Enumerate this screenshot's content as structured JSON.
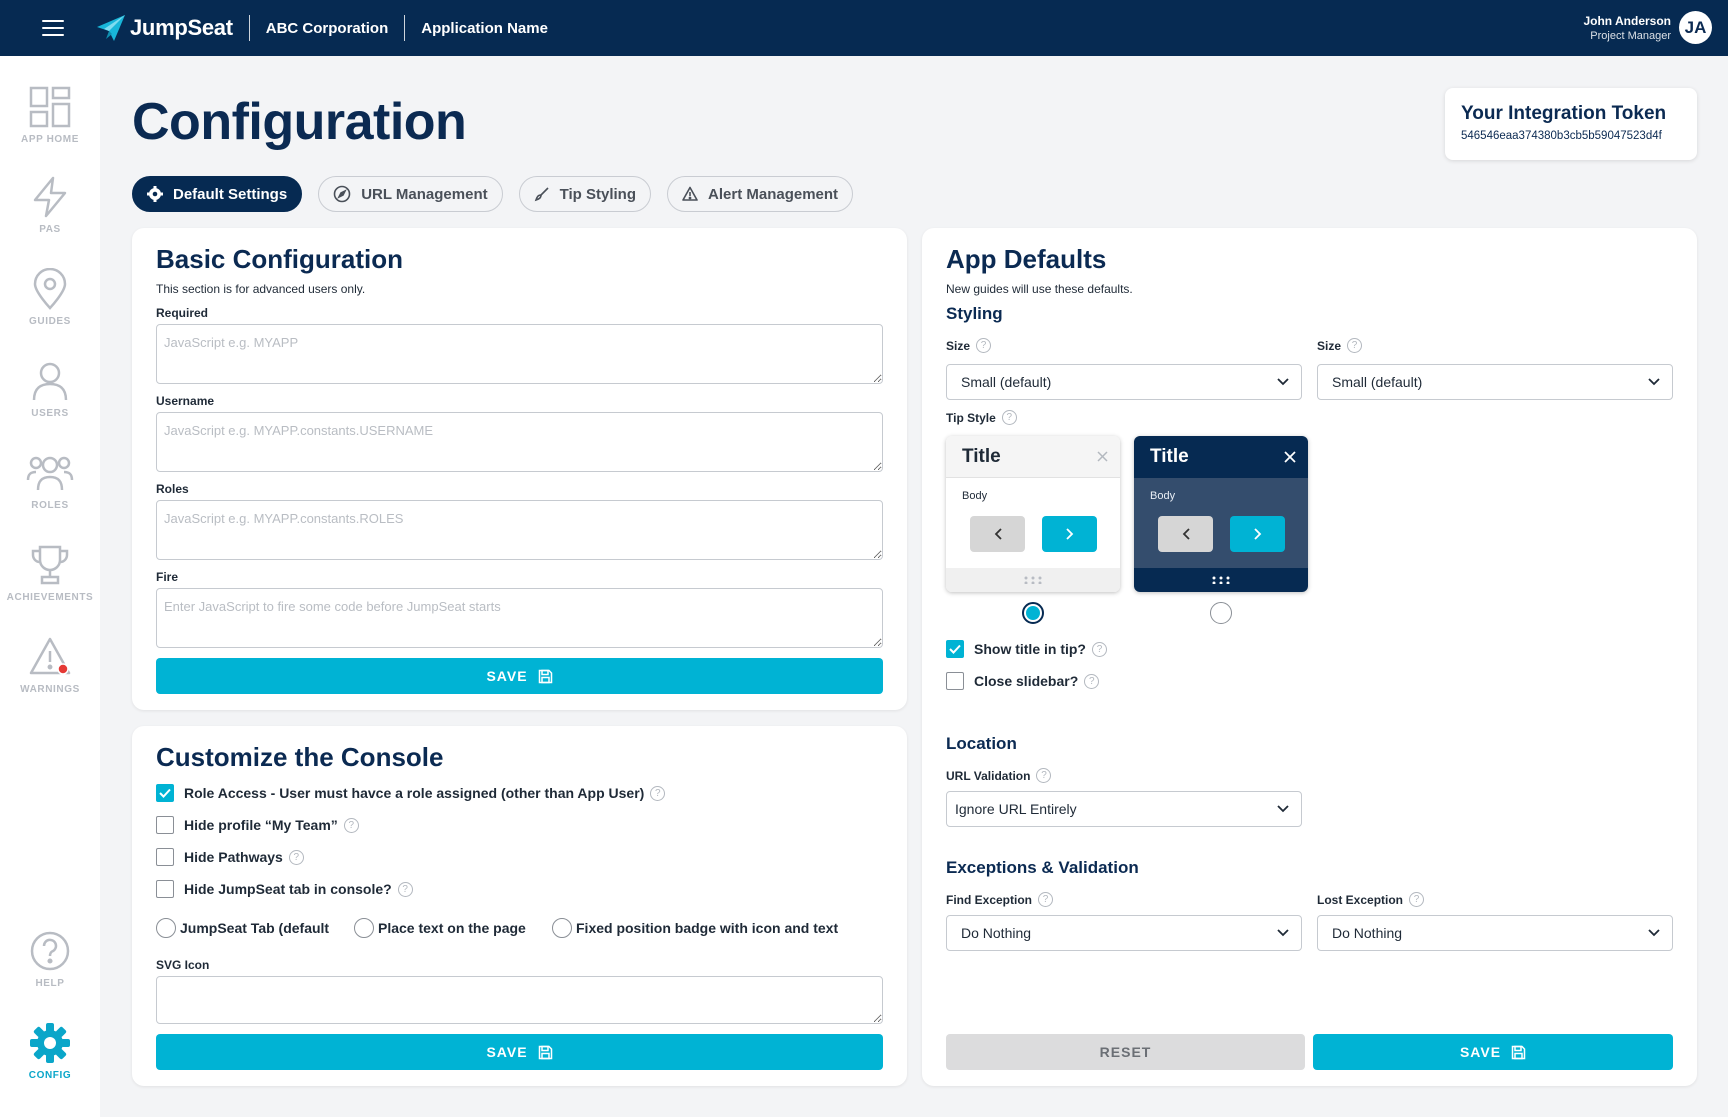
{
  "header": {
    "brand": "JumpSeat",
    "org": "ABC Corporation",
    "app": "Application Name",
    "user_name": "John Anderson",
    "user_role": "Project Manager",
    "user_initials": "JA"
  },
  "sidebar": {
    "items": [
      {
        "label": "APP HOME",
        "icon": "grid-icon"
      },
      {
        "label": "PAS",
        "icon": "lightning-icon"
      },
      {
        "label": "GUIDES",
        "icon": "map-pin-icon"
      },
      {
        "label": "USERS",
        "icon": "user-icon"
      },
      {
        "label": "ROLES",
        "icon": "users-icon"
      },
      {
        "label": "ACHIEVEMENTS",
        "icon": "trophy-icon"
      },
      {
        "label": "WARNINGS",
        "icon": "warning-icon"
      },
      {
        "label": "HELP",
        "icon": "help-icon"
      },
      {
        "label": "CONFIG",
        "icon": "gear-icon",
        "active": true
      }
    ]
  },
  "page": {
    "title": "Configuration",
    "token_title": "Your Integration Token",
    "token_value": "546546eaa374380b3cb5b59047523d4f"
  },
  "tabs": [
    {
      "label": "Default Settings",
      "active": true
    },
    {
      "label": "URL Management"
    },
    {
      "label": "Tip Styling"
    },
    {
      "label": "Alert Management"
    }
  ],
  "basic": {
    "title": "Basic Configuration",
    "subtitle": "This section is for advanced users only.",
    "required_label": "Required",
    "required_placeholder": "JavaScript e.g. MYAPP",
    "username_label": "Username",
    "username_placeholder": "JavaScript e.g. MYAPP.constants.USERNAME",
    "roles_label": "Roles",
    "roles_placeholder": "JavaScript e.g. MYAPP.constants.ROLES",
    "fire_label": "Fire",
    "fire_placeholder": "Enter JavaScript to fire some code before JumpSeat starts",
    "save_label": "SAVE"
  },
  "console": {
    "title": "Customize the Console",
    "checks": [
      {
        "label": "Role Access - User must havce a role assigned (other than App User)",
        "checked": true
      },
      {
        "label": "Hide profile “My Team”",
        "checked": false
      },
      {
        "label": "Hide Pathways",
        "checked": false
      },
      {
        "label": "Hide JumpSeat tab in console?",
        "checked": false
      }
    ],
    "radios": [
      "JumpSeat Tab (default",
      "Place text on the page",
      "Fixed position badge with icon and text"
    ],
    "svg_label": "SVG Icon",
    "save_label": "SAVE"
  },
  "defaults": {
    "title": "App Defaults",
    "subtitle": "New guides will use these defaults.",
    "styling_heading": "Styling",
    "size1_label": "Size",
    "size1_value": "Small (default)",
    "size2_label": "Size",
    "size2_value": "Small (default)",
    "tipstyle_label": "Tip Style",
    "tip_title": "Title",
    "tip_body": "Body",
    "tip_selected": 0,
    "show_title_label": "Show title in tip?",
    "show_title_checked": true,
    "close_slidebar_label": "Close slidebar?",
    "close_slidebar_checked": false,
    "location_heading": "Location",
    "url_validation_label": "URL Validation",
    "url_validation_value": "Ignore URL Entirely",
    "exceptions_heading": "Exceptions & Validation",
    "find_exception_label": "Find Exception",
    "find_exception_value": "Do Nothing",
    "lost_exception_label": "Lost Exception",
    "lost_exception_value": "Do Nothing",
    "reset_label": "RESET",
    "save_label": "SAVE"
  },
  "colors": {
    "navy": "#062a52",
    "accent": "#00b3d4",
    "alert": "#e53935"
  }
}
